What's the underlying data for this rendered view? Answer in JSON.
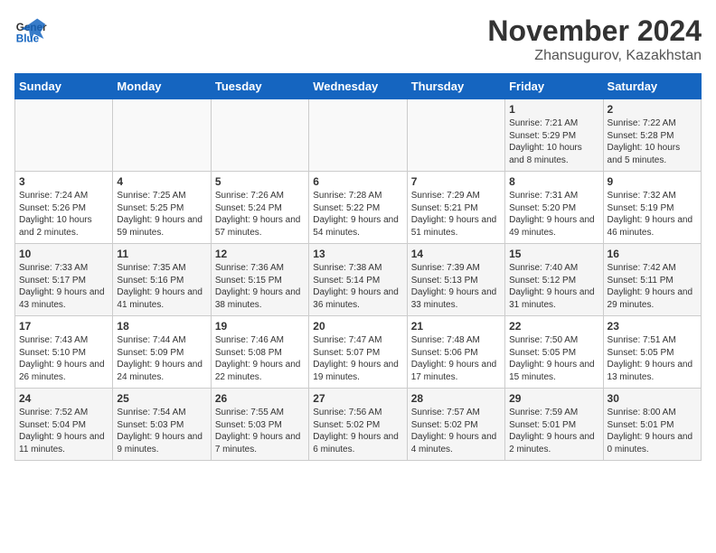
{
  "logo": {
    "line1": "General",
    "line2": "Blue"
  },
  "title": "November 2024",
  "location": "Zhansugurov, Kazakhstan",
  "days_of_week": [
    "Sunday",
    "Monday",
    "Tuesday",
    "Wednesday",
    "Thursday",
    "Friday",
    "Saturday"
  ],
  "weeks": [
    [
      {
        "day": "",
        "info": ""
      },
      {
        "day": "",
        "info": ""
      },
      {
        "day": "",
        "info": ""
      },
      {
        "day": "",
        "info": ""
      },
      {
        "day": "",
        "info": ""
      },
      {
        "day": "1",
        "info": "Sunrise: 7:21 AM\nSunset: 5:29 PM\nDaylight: 10 hours and 8 minutes."
      },
      {
        "day": "2",
        "info": "Sunrise: 7:22 AM\nSunset: 5:28 PM\nDaylight: 10 hours and 5 minutes."
      }
    ],
    [
      {
        "day": "3",
        "info": "Sunrise: 7:24 AM\nSunset: 5:26 PM\nDaylight: 10 hours and 2 minutes."
      },
      {
        "day": "4",
        "info": "Sunrise: 7:25 AM\nSunset: 5:25 PM\nDaylight: 9 hours and 59 minutes."
      },
      {
        "day": "5",
        "info": "Sunrise: 7:26 AM\nSunset: 5:24 PM\nDaylight: 9 hours and 57 minutes."
      },
      {
        "day": "6",
        "info": "Sunrise: 7:28 AM\nSunset: 5:22 PM\nDaylight: 9 hours and 54 minutes."
      },
      {
        "day": "7",
        "info": "Sunrise: 7:29 AM\nSunset: 5:21 PM\nDaylight: 9 hours and 51 minutes."
      },
      {
        "day": "8",
        "info": "Sunrise: 7:31 AM\nSunset: 5:20 PM\nDaylight: 9 hours and 49 minutes."
      },
      {
        "day": "9",
        "info": "Sunrise: 7:32 AM\nSunset: 5:19 PM\nDaylight: 9 hours and 46 minutes."
      }
    ],
    [
      {
        "day": "10",
        "info": "Sunrise: 7:33 AM\nSunset: 5:17 PM\nDaylight: 9 hours and 43 minutes."
      },
      {
        "day": "11",
        "info": "Sunrise: 7:35 AM\nSunset: 5:16 PM\nDaylight: 9 hours and 41 minutes."
      },
      {
        "day": "12",
        "info": "Sunrise: 7:36 AM\nSunset: 5:15 PM\nDaylight: 9 hours and 38 minutes."
      },
      {
        "day": "13",
        "info": "Sunrise: 7:38 AM\nSunset: 5:14 PM\nDaylight: 9 hours and 36 minutes."
      },
      {
        "day": "14",
        "info": "Sunrise: 7:39 AM\nSunset: 5:13 PM\nDaylight: 9 hours and 33 minutes."
      },
      {
        "day": "15",
        "info": "Sunrise: 7:40 AM\nSunset: 5:12 PM\nDaylight: 9 hours and 31 minutes."
      },
      {
        "day": "16",
        "info": "Sunrise: 7:42 AM\nSunset: 5:11 PM\nDaylight: 9 hours and 29 minutes."
      }
    ],
    [
      {
        "day": "17",
        "info": "Sunrise: 7:43 AM\nSunset: 5:10 PM\nDaylight: 9 hours and 26 minutes."
      },
      {
        "day": "18",
        "info": "Sunrise: 7:44 AM\nSunset: 5:09 PM\nDaylight: 9 hours and 24 minutes."
      },
      {
        "day": "19",
        "info": "Sunrise: 7:46 AM\nSunset: 5:08 PM\nDaylight: 9 hours and 22 minutes."
      },
      {
        "day": "20",
        "info": "Sunrise: 7:47 AM\nSunset: 5:07 PM\nDaylight: 9 hours and 19 minutes."
      },
      {
        "day": "21",
        "info": "Sunrise: 7:48 AM\nSunset: 5:06 PM\nDaylight: 9 hours and 17 minutes."
      },
      {
        "day": "22",
        "info": "Sunrise: 7:50 AM\nSunset: 5:05 PM\nDaylight: 9 hours and 15 minutes."
      },
      {
        "day": "23",
        "info": "Sunrise: 7:51 AM\nSunset: 5:05 PM\nDaylight: 9 hours and 13 minutes."
      }
    ],
    [
      {
        "day": "24",
        "info": "Sunrise: 7:52 AM\nSunset: 5:04 PM\nDaylight: 9 hours and 11 minutes."
      },
      {
        "day": "25",
        "info": "Sunrise: 7:54 AM\nSunset: 5:03 PM\nDaylight: 9 hours and 9 minutes."
      },
      {
        "day": "26",
        "info": "Sunrise: 7:55 AM\nSunset: 5:03 PM\nDaylight: 9 hours and 7 minutes."
      },
      {
        "day": "27",
        "info": "Sunrise: 7:56 AM\nSunset: 5:02 PM\nDaylight: 9 hours and 6 minutes."
      },
      {
        "day": "28",
        "info": "Sunrise: 7:57 AM\nSunset: 5:02 PM\nDaylight: 9 hours and 4 minutes."
      },
      {
        "day": "29",
        "info": "Sunrise: 7:59 AM\nSunset: 5:01 PM\nDaylight: 9 hours and 2 minutes."
      },
      {
        "day": "30",
        "info": "Sunrise: 8:00 AM\nSunset: 5:01 PM\nDaylight: 9 hours and 0 minutes."
      }
    ]
  ]
}
